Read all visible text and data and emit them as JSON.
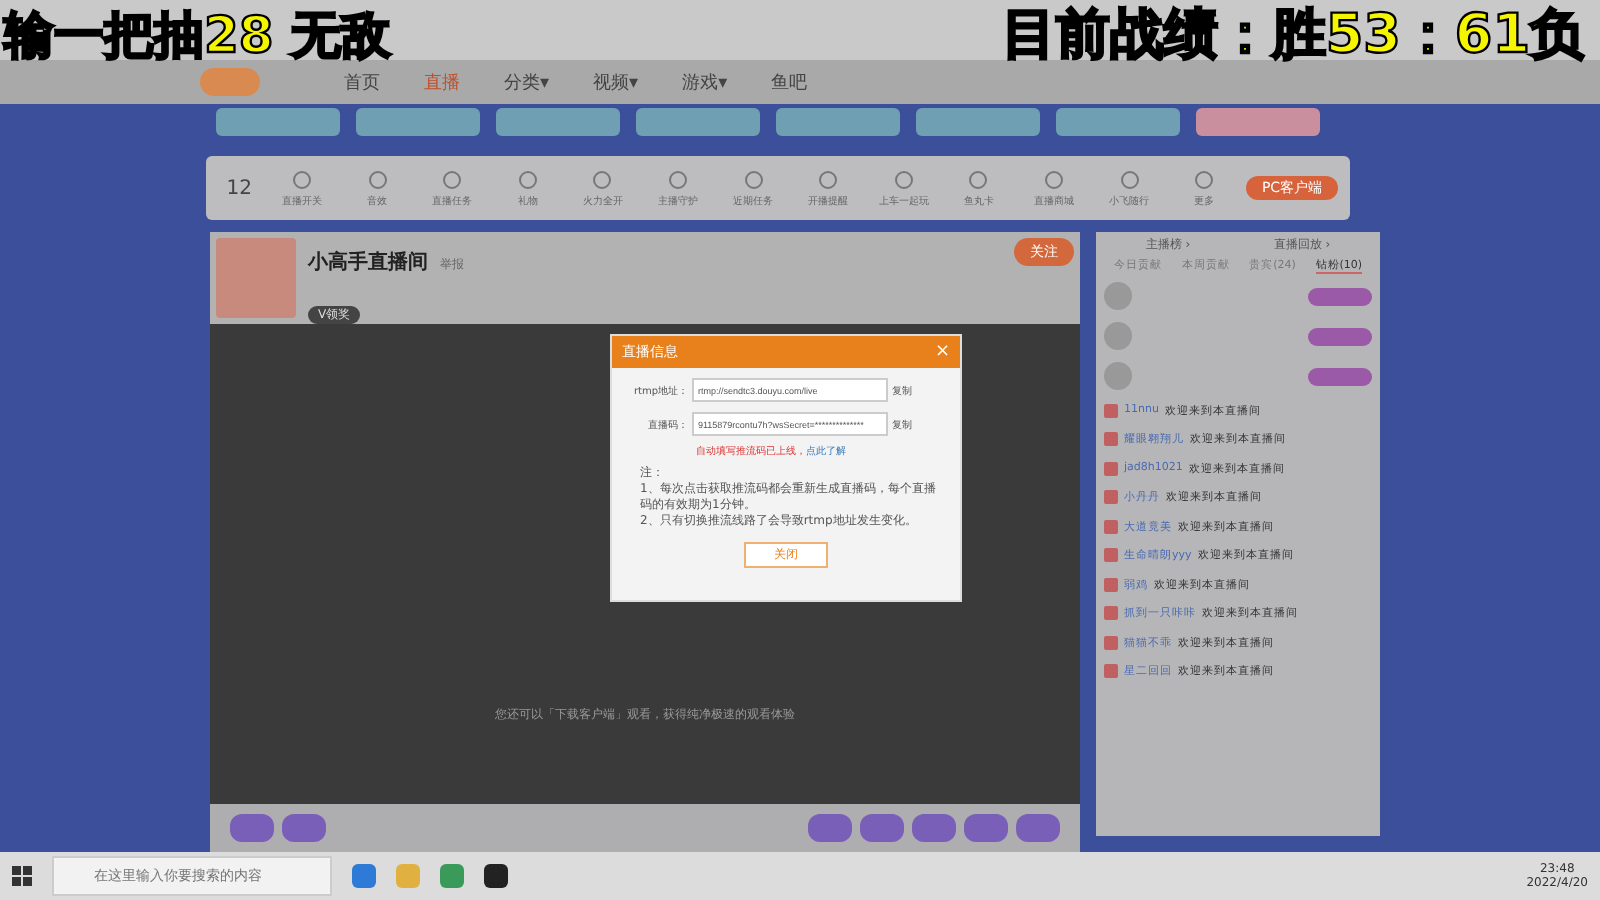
{
  "captions": {
    "left": "输一把抽28 无敌",
    "right": "目前战绩：胜53：61负"
  },
  "nav": {
    "items": [
      {
        "label": "首页",
        "selected": false
      },
      {
        "label": "直播",
        "selected": true
      },
      {
        "label": "分类▾",
        "selected": false
      },
      {
        "label": "视频▾",
        "selected": false
      },
      {
        "label": "游戏▾",
        "selected": false
      },
      {
        "label": "鱼吧",
        "selected": false
      }
    ]
  },
  "toolbar": {
    "count": "12",
    "items": [
      "直播开关",
      "音效",
      "直播任务",
      "礼物",
      "火力全开",
      "主播守护",
      "近期任务",
      "开播提醒",
      "上车一起玩",
      "鱼丸卡",
      "直播商城",
      "小飞随行",
      "更多"
    ],
    "client_button": "PC客户端"
  },
  "room": {
    "title": "小高手直播间",
    "report": "举报",
    "follow": "关注",
    "level": "V领奖"
  },
  "dialog": {
    "title": "直播信息",
    "close": "×",
    "rtmp_label": "rtmp地址：",
    "rtmp_value": "rtmp://sendtc3.douyu.com/live",
    "code_label": "直播码：",
    "code_value": "9115879rcontu7h?wsSecret=**************",
    "copy": [
      "复制",
      "复制"
    ],
    "warning": "自动填写推流码已上线，",
    "learn_more": "点此了解",
    "notes": [
      "注：",
      "1、每次点击获取推流码都会重新生成直播码，每个直播码的有效期为1分钟。",
      "2、只有切换推流线路了会导致rtmp地址发生变化。"
    ],
    "button": "关闭"
  },
  "video_hint": "您还可以「下载客户端」观看，获得纯净极速的观看体验",
  "chat": {
    "tabs": [
      "主播榜 ›",
      "直播回放 ›"
    ],
    "rank_tabs": [
      {
        "label": "今日贡献",
        "selected": false
      },
      {
        "label": "本周贡献",
        "selected": false
      },
      {
        "label": "贵宾(24)",
        "selected": false
      },
      {
        "label": "钻粉(10)",
        "selected": true
      }
    ],
    "messages": [
      {
        "name": "11nnu",
        "text": "欢迎来到本直播间"
      },
      {
        "name": "耀眼翱翔儿",
        "text": "欢迎来到本直播间"
      },
      {
        "name": "jad8h1021",
        "text": "欢迎来到本直播间"
      },
      {
        "name": "小丹丹",
        "text": "欢迎来到本直播间"
      },
      {
        "name": "大道竟美",
        "text": "欢迎来到本直播间"
      },
      {
        "name": "生命晴朗yyy",
        "text": "欢迎来到本直播间"
      },
      {
        "name": "弱鸡",
        "text": "欢迎来到本直播间"
      },
      {
        "name": "抓到一只咔咔",
        "text": "欢迎来到本直播间"
      },
      {
        "name": "猫猫不乖",
        "text": "欢迎来到本直播间"
      },
      {
        "name": "星二回回",
        "text": "欢迎来到本直播间"
      }
    ]
  },
  "taskbar": {
    "placeholder": "在这里输入你要搜索的内容",
    "time": "23:48",
    "date": "2022/4/20"
  }
}
